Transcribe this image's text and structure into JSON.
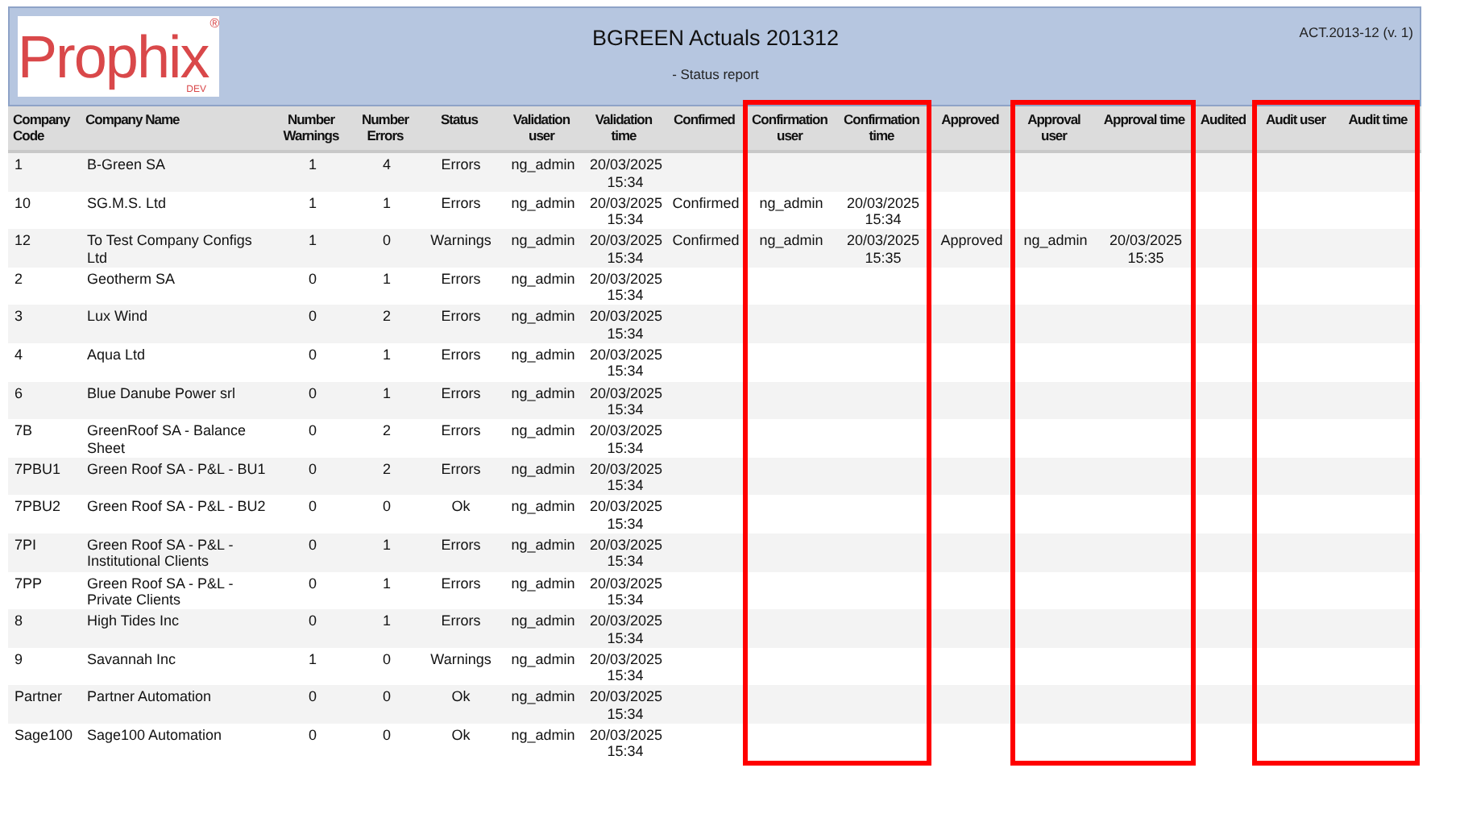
{
  "header": {
    "logo": {
      "name": "Prophix",
      "mark": "®",
      "tag": "DEV"
    },
    "title": "BGREEN Actuals 201312",
    "subtitle": "- Status report",
    "version": "ACT.2013-12 (v. 1)"
  },
  "columns": [
    "Company Code",
    "Company Name",
    "Number Warnings",
    "Number Errors",
    "Status",
    "Validation user",
    "Validation time",
    "Confirmed",
    "Confirmation user",
    "Confirmation time",
    "Approved",
    "Approval user",
    "Approval time",
    "Audited",
    "Audit user",
    "Audit time"
  ],
  "rows": [
    [
      "1",
      "B-Green SA",
      "1",
      "4",
      "Errors",
      "ng_admin",
      "20/03/2025 15:34",
      null,
      null,
      null,
      null,
      null,
      null,
      null,
      null,
      null
    ],
    [
      "10",
      "SG.M.S. Ltd",
      "1",
      "1",
      "Errors",
      "ng_admin",
      "20/03/2025 15:34",
      "Confirmed",
      "ng_admin",
      "20/03/2025 15:34",
      null,
      null,
      null,
      null,
      null,
      null
    ],
    [
      "12",
      "To Test Company Configs Ltd",
      "1",
      "0",
      "Warnings",
      "ng_admin",
      "20/03/2025 15:34",
      "Confirmed",
      "ng_admin",
      "20/03/2025 15:35",
      "Approved",
      "ng_admin",
      "20/03/2025 15:35",
      null,
      null,
      null
    ],
    [
      "2",
      "Geotherm SA",
      "0",
      "1",
      "Errors",
      "ng_admin",
      "20/03/2025 15:34",
      null,
      null,
      null,
      null,
      null,
      null,
      null,
      null,
      null
    ],
    [
      "3",
      "Lux Wind",
      "0",
      "2",
      "Errors",
      "ng_admin",
      "20/03/2025 15:34",
      null,
      null,
      null,
      null,
      null,
      null,
      null,
      null,
      null
    ],
    [
      "4",
      "Aqua Ltd",
      "0",
      "1",
      "Errors",
      "ng_admin",
      "20/03/2025 15:34",
      null,
      null,
      null,
      null,
      null,
      null,
      null,
      null,
      null
    ],
    [
      "6",
      "Blue Danube Power srl",
      "0",
      "1",
      "Errors",
      "ng_admin",
      "20/03/2025 15:34",
      null,
      null,
      null,
      null,
      null,
      null,
      null,
      null,
      null
    ],
    [
      "7B",
      "GreenRoof SA - Balance Sheet",
      "0",
      "2",
      "Errors",
      "ng_admin",
      "20/03/2025 15:34",
      null,
      null,
      null,
      null,
      null,
      null,
      null,
      null,
      null
    ],
    [
      "7PBU1",
      "Green Roof SA - P&L - BU1",
      "0",
      "2",
      "Errors",
      "ng_admin",
      "20/03/2025 15:34",
      null,
      null,
      null,
      null,
      null,
      null,
      null,
      null,
      null
    ],
    [
      "7PBU2",
      "Green Roof SA - P&L - BU2",
      "0",
      "0",
      "Ok",
      "ng_admin",
      "20/03/2025 15:34",
      null,
      null,
      null,
      null,
      null,
      null,
      null,
      null,
      null
    ],
    [
      "7PI",
      "Green Roof SA - P&L - Institutional Clients",
      "0",
      "1",
      "Errors",
      "ng_admin",
      "20/03/2025 15:34",
      null,
      null,
      null,
      null,
      null,
      null,
      null,
      null,
      null
    ],
    [
      "7PP",
      "Green Roof SA - P&L - Private Clients",
      "0",
      "1",
      "Errors",
      "ng_admin",
      "20/03/2025 15:34",
      null,
      null,
      null,
      null,
      null,
      null,
      null,
      null,
      null
    ],
    [
      "8",
      "High Tides Inc",
      "0",
      "1",
      "Errors",
      "ng_admin",
      "20/03/2025 15:34",
      null,
      null,
      null,
      null,
      null,
      null,
      null,
      null,
      null
    ],
    [
      "9",
      "Savannah Inc",
      "1",
      "0",
      "Warnings",
      "ng_admin",
      "20/03/2025 15:34",
      null,
      null,
      null,
      null,
      null,
      null,
      null,
      null,
      null
    ],
    [
      "Partner",
      "Partner Automation",
      "0",
      "0",
      "Ok",
      "ng_admin",
      "20/03/2025 15:34",
      null,
      null,
      null,
      null,
      null,
      null,
      null,
      null,
      null
    ],
    [
      "Sage100",
      "Sage100 Automation",
      "0",
      "0",
      "Ok",
      "ng_admin",
      "20/03/2025 15:34",
      null,
      null,
      null,
      null,
      null,
      null,
      null,
      null,
      null
    ]
  ]
}
